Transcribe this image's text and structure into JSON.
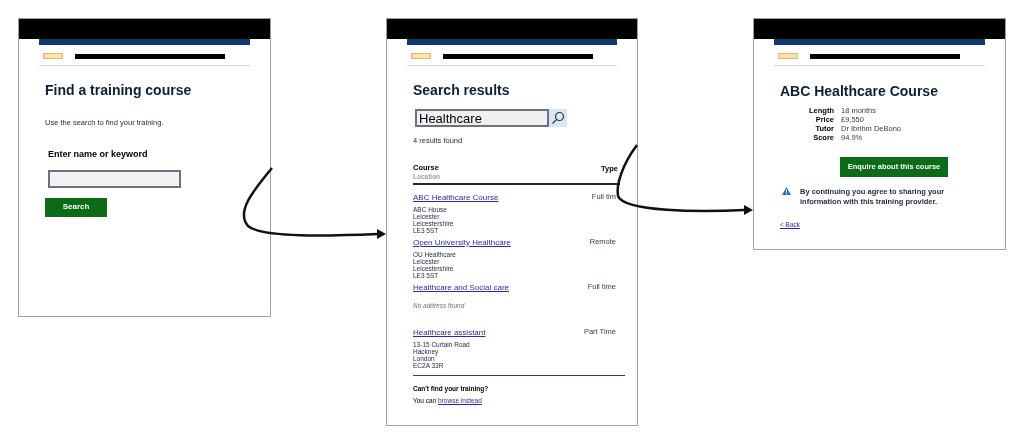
{
  "screens": [
    {
      "kind": "search",
      "title": "Find a training course",
      "intro": "Use the search to find your training.",
      "field_label": "Enter name or keyword",
      "button": "Search"
    },
    {
      "kind": "results",
      "title": "Search results",
      "search_value": "Healthcare",
      "count": "4 results found",
      "columns": [
        "Course",
        "Type"
      ],
      "subheading": "Location",
      "results": [
        {
          "title": "ABC Healthcare Course",
          "type": "Full tim",
          "address": [
            "ABC House",
            "Leicester",
            "Leicestershire",
            "LE3 5ST"
          ]
        },
        {
          "title": "Open University Healthcare",
          "type": "Remote",
          "address": [
            "OU Healthcare",
            "Leicester",
            "Leicestershire",
            "LE3 5ST"
          ]
        },
        {
          "title": "Healthcare and Social care",
          "type": "Full time",
          "note": "No address found"
        },
        {
          "title": "Healthcare assistant",
          "type": "Part Time",
          "address": [
            "13-15 Curtain Road",
            "Hackney",
            "London",
            "EC2A 33R"
          ]
        }
      ],
      "footer_heading": "Can't find your training?",
      "footer_text": "You can",
      "footer_link": "browse instead"
    },
    {
      "kind": "detail",
      "title": "ABC Healthcare Course",
      "details": [
        {
          "label": "Length",
          "value": "18 months"
        },
        {
          "label": "Price",
          "value": "£9,550"
        },
        {
          "label": "Tutor",
          "value": "Dr Ibrihm DeBono"
        },
        {
          "label": "Score",
          "value": "94.9%"
        }
      ],
      "button": "Enquire about this course",
      "warning": "By continuing you agree to sharing your information with this training provider.",
      "back": "< Back"
    }
  ]
}
